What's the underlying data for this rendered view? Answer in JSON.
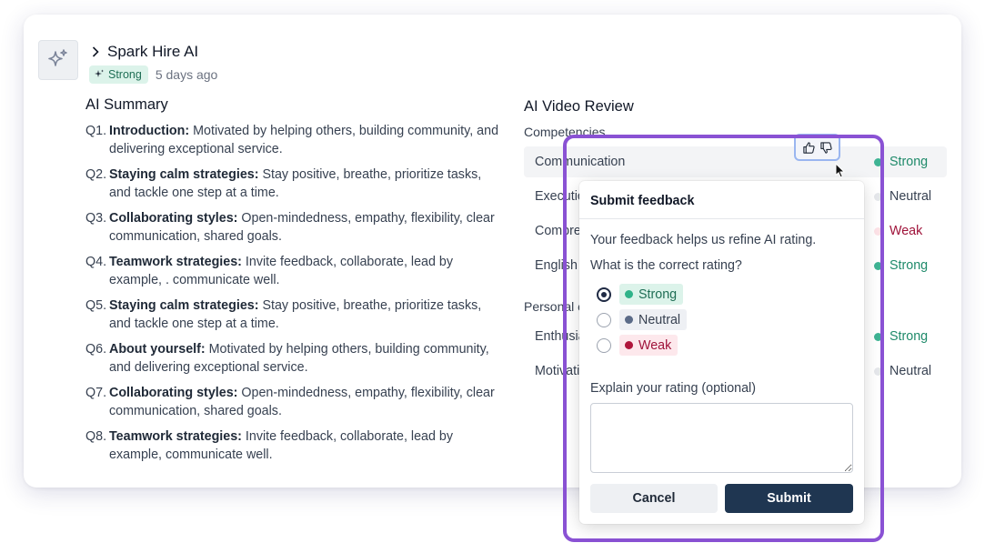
{
  "header": {
    "title": "Spark Hire AI",
    "badge": "Strong",
    "timestamp": "5 days ago",
    "avatar_icon": "sparkle-icon"
  },
  "summary": {
    "title": "AI Summary",
    "items": [
      {
        "num": "Q1.",
        "label": "Introduction:",
        "text": " Motivated by helping others, building community, and delivering  exceptional service."
      },
      {
        "num": "Q2.",
        "label": "Staying calm strategies:",
        "text": " Stay positive, breathe, prioritize tasks, and tackle one step at a time."
      },
      {
        "num": "Q3.",
        "label": "Collaborating styles:",
        "text": " Open-mindedness, empathy, flexibility, clear communication, shared goals."
      },
      {
        "num": "Q4.",
        "label": "Teamwork strategies:",
        "text": " Invite feedback, collaborate, lead by example,  . communicate well."
      },
      {
        "num": "Q5.",
        "label": "Staying calm strategies:",
        "text": " Stay positive, breathe, prioritize tasks, and tackle one step at a time."
      },
      {
        "num": "Q6.",
        "label": "About yourself:",
        "text": " Motivated by helping others, building community, and delivering  exceptional service."
      },
      {
        "num": "Q7.",
        "label": "Collaborating styles:",
        "text": " Open-mindedness, empathy, flexibility, clear communication, shared goals."
      },
      {
        "num": "Q8.",
        "label": "Teamwork strategies:",
        "text": " Invite feedback, collaborate, lead by example, communicate well."
      }
    ]
  },
  "review": {
    "title": "AI Video Review",
    "competencies_label": "Competencies",
    "personal_label": "Personal c",
    "rows": [
      {
        "name": "Communication",
        "rating": "Strong",
        "color": "#3fb394",
        "text_color": "#1f8a6a"
      },
      {
        "name": "Executio",
        "rating": "Neutral",
        "color": "#e5e7eb",
        "text_color": "#374151"
      },
      {
        "name": "Compre",
        "rating": "Weak",
        "color": "#fde2e7",
        "text_color": "#9f1239"
      },
      {
        "name": "English",
        "rating": "Strong",
        "color": "#3fb394",
        "text_color": "#1f8a6a"
      },
      {
        "name": "Enthusia",
        "rating": "Strong",
        "color": "#3fb394",
        "text_color": "#1f8a6a"
      },
      {
        "name": "Motivati",
        "rating": "Neutral",
        "color": "#e5e7eb",
        "text_color": "#374151"
      }
    ]
  },
  "feedback": {
    "title": "Submit feedback",
    "description": "Your feedback helps us refine AI rating.",
    "question": "What is the correct rating?",
    "options": [
      {
        "label": "Strong",
        "selected": true,
        "dot_color": "#2fb389"
      },
      {
        "label": "Neutral",
        "selected": false,
        "dot_color": "#5b6b88"
      },
      {
        "label": "Weak",
        "selected": false,
        "dot_color": "#b0163c"
      }
    ],
    "explain_label": "Explain your rating (optional)",
    "explain_value": "",
    "cancel_label": "Cancel",
    "submit_label": "Submit"
  },
  "colors": {
    "highlight_outline": "#8a52d4",
    "submit_bg": "#1f3651",
    "thumbs_border": "#9ab6f0"
  }
}
